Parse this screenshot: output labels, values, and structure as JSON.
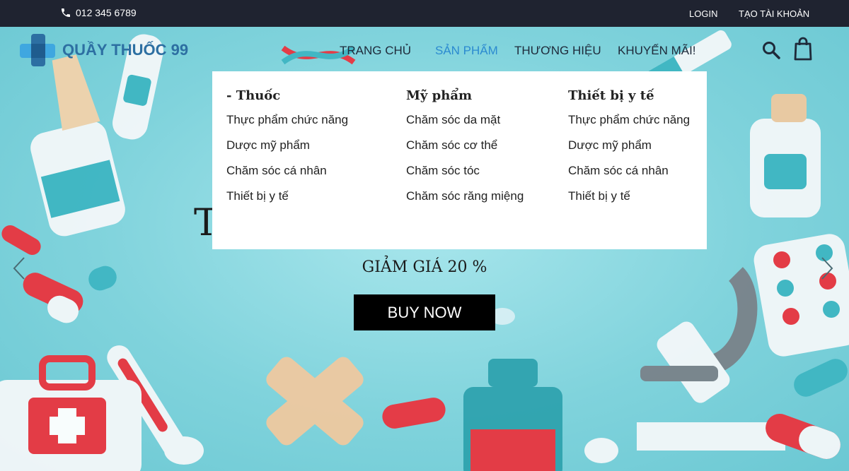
{
  "topbar": {
    "phone": "012 345 6789",
    "login": "LOGIN",
    "register": "TẠO TÀI KHOẢN"
  },
  "header": {
    "brand": "QUẦY THUỐC 99",
    "nav": [
      "TRANG CHỦ",
      "SẢN PHẨM",
      "THƯƠNG HIỆU",
      "KHUYẾN MÃI!"
    ],
    "active_index": 1
  },
  "dropdown": {
    "columns": [
      {
        "title": "- Thuốc",
        "items": [
          "Thực phẩm chức năng",
          "Dược mỹ phẩm",
          "Chăm sóc cá nhân",
          "Thiết bị y tế"
        ]
      },
      {
        "title": "Mỹ phẩm",
        "items": [
          "Chăm sóc da mặt",
          "Chăm sóc cơ thể",
          "Chăm sóc tóc",
          "Chăm sóc răng miệng"
        ]
      },
      {
        "title": "Thiết bị y tế",
        "items": [
          "Thực phẩm chức năng",
          "Dược mỹ phẩm",
          "Chăm sóc cá nhân",
          "Thiết bị y tế"
        ]
      }
    ]
  },
  "slide": {
    "partial_title": "T",
    "discount": "GIẢM GIÁ 20 %",
    "button": "BUY NOW"
  },
  "colors": {
    "topbar": "#1f2330",
    "brand": "#2d6fa2",
    "active_nav": "#2b8ad0",
    "hero": "#80d3dc",
    "button": "#000000"
  },
  "icons": [
    "phone-icon",
    "logo-icon",
    "search-icon",
    "cart-icon",
    "chevron-left-icon",
    "chevron-right-icon"
  ]
}
